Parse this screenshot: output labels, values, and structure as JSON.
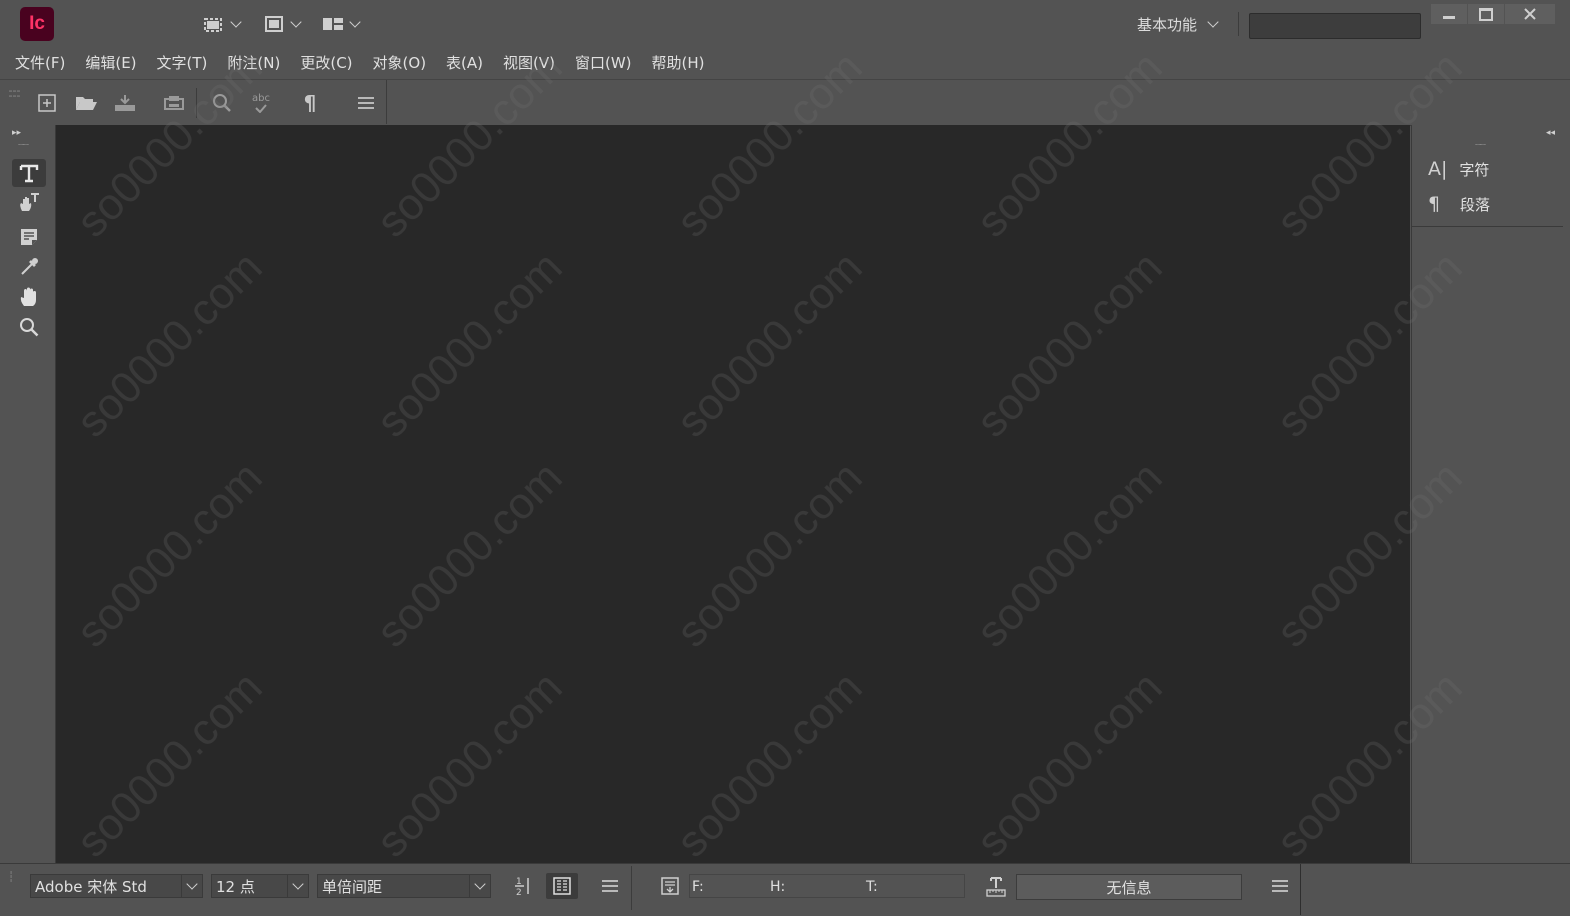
{
  "app": {
    "logo_text": "Ic",
    "brand_color": "#49021f",
    "accent_color": "#ff3366"
  },
  "titlebar": {
    "workspace_label": "基本功能",
    "search_value": ""
  },
  "window_controls": {
    "minimize": "minimize-icon",
    "restore": "restore-icon",
    "close": "close-icon"
  },
  "menu": [
    {
      "label": "文件(F)"
    },
    {
      "label": "编辑(E)"
    },
    {
      "label": "文字(T)"
    },
    {
      "label": "附注(N)"
    },
    {
      "label": "更改(C)"
    },
    {
      "label": "对象(O)"
    },
    {
      "label": "表(A)"
    },
    {
      "label": "视图(V)"
    },
    {
      "label": "窗口(W)"
    },
    {
      "label": "帮助(H)"
    }
  ],
  "toolbar": {
    "spell_icon_text": "abc",
    "pilcrow": "¶"
  },
  "right_panel": {
    "items": [
      {
        "label": "字符",
        "icon": "A|"
      },
      {
        "label": "段落",
        "icon": "¶"
      }
    ]
  },
  "status": {
    "font": "Adobe 宋体 Std",
    "size": "12 点",
    "spacing": "单倍间距",
    "f_label": "F:",
    "h_label": "H:",
    "t_label": "T:",
    "info": "无信息"
  },
  "watermark": "so0000.com"
}
